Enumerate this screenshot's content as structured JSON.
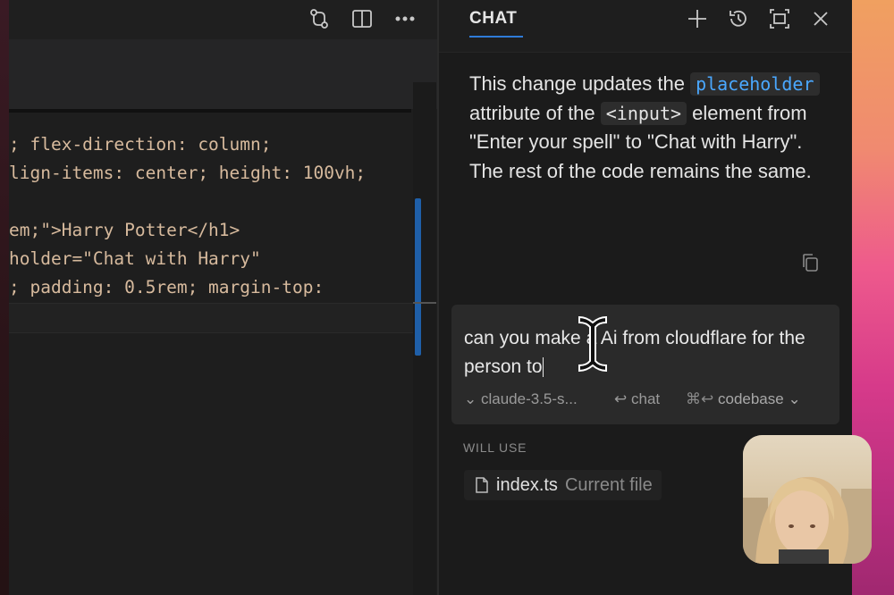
{
  "editor": {
    "code_lines": [
      "; flex-direction: column;",
      "lign-items: center; height: 100vh;",
      "",
      "em;\">Harry Potter</h1>",
      "holder=\"Chat with Harry\"",
      "; padding: 0.5rem; margin-top:"
    ],
    "actions": [
      "source-control-icon",
      "split-editor-icon",
      "more-actions-icon"
    ]
  },
  "chat": {
    "title": "CHAT",
    "header_actions": [
      "plus-icon",
      "history-icon",
      "maximize-icon",
      "close-icon"
    ],
    "message": {
      "part1": "This change updates the ",
      "code1": "placeholder",
      "part2": " attribute of the ",
      "code2": "<input>",
      "part3": " element from \"Enter your spell\" to \"Chat with Harry\". The rest of the code remains the same."
    },
    "input": {
      "text": "can you make a Ai from cloudflare for the person to"
    },
    "model_label": "claude-3.5-s...",
    "chat_label": "chat",
    "codebase_kbd": "⌘↩",
    "codebase_label": "codebase",
    "will_use_label": "WILL USE",
    "file": {
      "name": "index.ts",
      "note": "Current file"
    }
  },
  "colors": {
    "accent": "#2f7bd8",
    "code_highlight": "#4aa8ff",
    "code_text": "#d7ba9d"
  }
}
